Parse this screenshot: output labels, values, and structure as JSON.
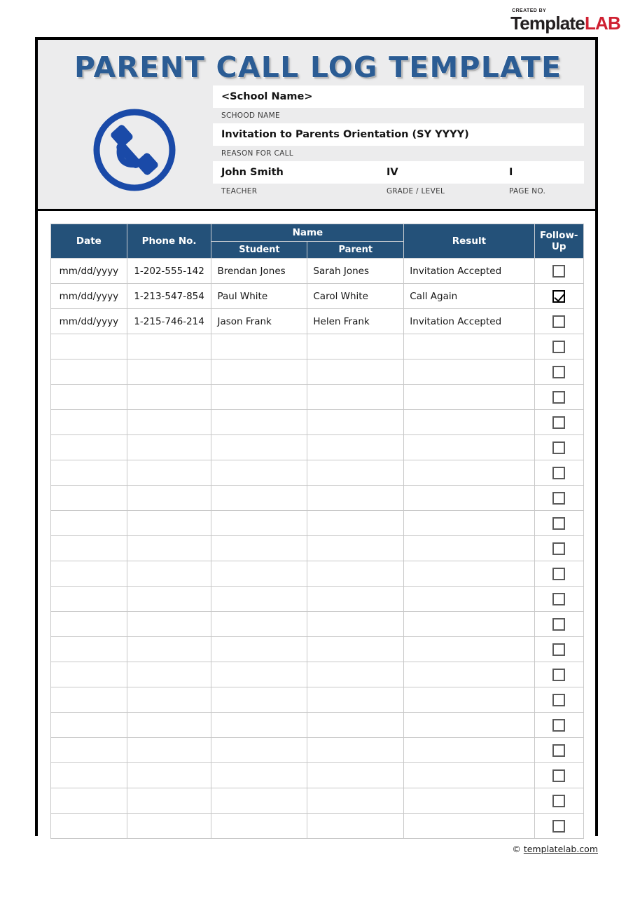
{
  "brand": {
    "created_by": "CREATED BY",
    "name_part1": "Template",
    "name_part2": "LAB",
    "color_dark": "#231f20",
    "color_red": "#cf2031"
  },
  "document": {
    "title": "PARENT CALL LOG TEMPLATE",
    "title_color": "#2b5c94",
    "header_band_color": "#ececed",
    "table_header_color": "#245179"
  },
  "icon": {
    "name": "phone-in-circle-icon",
    "color": "#1a4aa8"
  },
  "fields": {
    "school_name": {
      "value": "<School Name>",
      "caption": "SCHOOD NAME"
    },
    "reason_for_call": {
      "value": "Invitation to Parents Orientation (SY YYYY)",
      "caption": "REASON FOR CALL"
    },
    "teacher": {
      "value": "John Smith",
      "caption": "TEACHER"
    },
    "grade_level": {
      "value": "IV",
      "caption": "GRADE / LEVEL"
    },
    "page_no": {
      "value": "I",
      "caption": "PAGE NO."
    }
  },
  "table": {
    "headers": {
      "date": "Date",
      "phone": "Phone No.",
      "name_group": "Name",
      "student": "Student",
      "parent": "Parent",
      "result": "Result",
      "follow_up": "Follow-Up"
    },
    "rows": [
      {
        "date": "mm/dd/yyyy",
        "phone": "1-202-555-142",
        "student": "Brendan Jones",
        "parent": "Sarah Jones",
        "result": "Invitation Accepted",
        "follow_up": false
      },
      {
        "date": "mm/dd/yyyy",
        "phone": "1-213-547-854",
        "student": "Paul White",
        "parent": "Carol White",
        "result": "Call Again",
        "follow_up": true
      },
      {
        "date": "mm/dd/yyyy",
        "phone": "1-215-746-214",
        "student": "Jason Frank",
        "parent": "Helen Frank",
        "result": "Invitation Accepted",
        "follow_up": false
      },
      {
        "date": "",
        "phone": "",
        "student": "",
        "parent": "",
        "result": "",
        "follow_up": false
      },
      {
        "date": "",
        "phone": "",
        "student": "",
        "parent": "",
        "result": "",
        "follow_up": false
      },
      {
        "date": "",
        "phone": "",
        "student": "",
        "parent": "",
        "result": "",
        "follow_up": false
      },
      {
        "date": "",
        "phone": "",
        "student": "",
        "parent": "",
        "result": "",
        "follow_up": false
      },
      {
        "date": "",
        "phone": "",
        "student": "",
        "parent": "",
        "result": "",
        "follow_up": false
      },
      {
        "date": "",
        "phone": "",
        "student": "",
        "parent": "",
        "result": "",
        "follow_up": false
      },
      {
        "date": "",
        "phone": "",
        "student": "",
        "parent": "",
        "result": "",
        "follow_up": false
      },
      {
        "date": "",
        "phone": "",
        "student": "",
        "parent": "",
        "result": "",
        "follow_up": false
      },
      {
        "date": "",
        "phone": "",
        "student": "",
        "parent": "",
        "result": "",
        "follow_up": false
      },
      {
        "date": "",
        "phone": "",
        "student": "",
        "parent": "",
        "result": "",
        "follow_up": false
      },
      {
        "date": "",
        "phone": "",
        "student": "",
        "parent": "",
        "result": "",
        "follow_up": false
      },
      {
        "date": "",
        "phone": "",
        "student": "",
        "parent": "",
        "result": "",
        "follow_up": false
      },
      {
        "date": "",
        "phone": "",
        "student": "",
        "parent": "",
        "result": "",
        "follow_up": false
      },
      {
        "date": "",
        "phone": "",
        "student": "",
        "parent": "",
        "result": "",
        "follow_up": false
      },
      {
        "date": "",
        "phone": "",
        "student": "",
        "parent": "",
        "result": "",
        "follow_up": false
      },
      {
        "date": "",
        "phone": "",
        "student": "",
        "parent": "",
        "result": "",
        "follow_up": false
      },
      {
        "date": "",
        "phone": "",
        "student": "",
        "parent": "",
        "result": "",
        "follow_up": false
      },
      {
        "date": "",
        "phone": "",
        "student": "",
        "parent": "",
        "result": "",
        "follow_up": false
      },
      {
        "date": "",
        "phone": "",
        "student": "",
        "parent": "",
        "result": "",
        "follow_up": false
      },
      {
        "date": "",
        "phone": "",
        "student": "",
        "parent": "",
        "result": "",
        "follow_up": false
      }
    ]
  },
  "footer": {
    "copyright_symbol": "©",
    "site": "templatelab.com"
  }
}
